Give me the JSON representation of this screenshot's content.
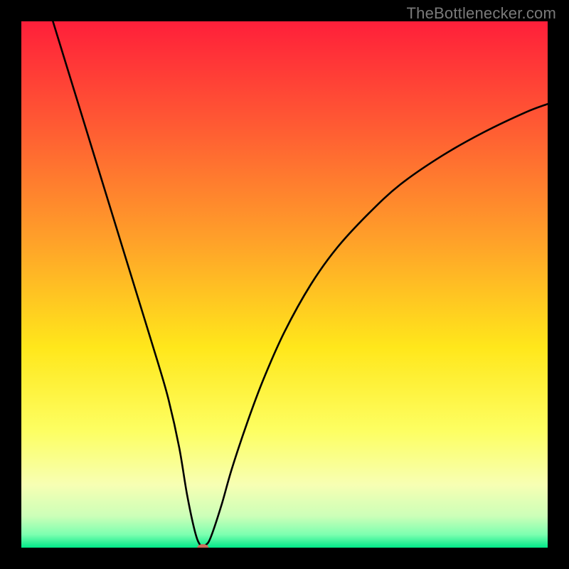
{
  "attribution": "TheBottlenecker.com",
  "chart_data": {
    "type": "line",
    "title": "",
    "xlabel": "",
    "ylabel": "",
    "xlim": [
      0,
      100
    ],
    "ylim": [
      0,
      100
    ],
    "gradient_stops": [
      {
        "offset": 0,
        "color": "#ff1f3a"
      },
      {
        "offset": 0.2,
        "color": "#ff5b33"
      },
      {
        "offset": 0.42,
        "color": "#ffa229"
      },
      {
        "offset": 0.62,
        "color": "#ffe71b"
      },
      {
        "offset": 0.78,
        "color": "#fdff63"
      },
      {
        "offset": 0.88,
        "color": "#f7ffb3"
      },
      {
        "offset": 0.94,
        "color": "#ccffb8"
      },
      {
        "offset": 0.975,
        "color": "#7dffb0"
      },
      {
        "offset": 1.0,
        "color": "#00e888"
      }
    ],
    "series": [
      {
        "name": "bottleneck-curve",
        "type": "line",
        "x": [
          6,
          10,
          14,
          18,
          22,
          26,
          28,
          30,
          31.5,
          33,
          34,
          35,
          36,
          38,
          40,
          43,
          46,
          50,
          55,
          60,
          66,
          72,
          80,
          88,
          96,
          100
        ],
        "y": [
          100,
          87,
          74,
          61,
          48,
          35,
          28,
          19,
          10,
          3,
          0.5,
          0.5,
          2,
          8,
          15,
          24,
          32,
          41,
          50,
          57,
          63.5,
          69,
          74.5,
          79,
          82.8,
          84.3
        ]
      }
    ],
    "marker": {
      "x": 34.5,
      "y": 0,
      "color": "#cc6d5d",
      "rx": 8,
      "ry": 5
    }
  }
}
